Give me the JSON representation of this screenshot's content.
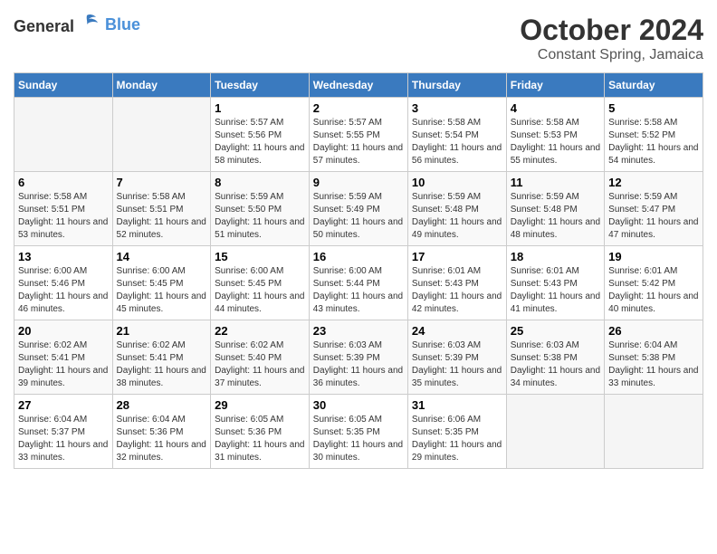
{
  "header": {
    "logo_general": "General",
    "logo_blue": "Blue",
    "month": "October 2024",
    "location": "Constant Spring, Jamaica"
  },
  "days_of_week": [
    "Sunday",
    "Monday",
    "Tuesday",
    "Wednesday",
    "Thursday",
    "Friday",
    "Saturday"
  ],
  "weeks": [
    [
      {
        "day": "",
        "info": ""
      },
      {
        "day": "",
        "info": ""
      },
      {
        "day": "1",
        "info": "Sunrise: 5:57 AM\nSunset: 5:56 PM\nDaylight: 11 hours and 58 minutes."
      },
      {
        "day": "2",
        "info": "Sunrise: 5:57 AM\nSunset: 5:55 PM\nDaylight: 11 hours and 57 minutes."
      },
      {
        "day": "3",
        "info": "Sunrise: 5:58 AM\nSunset: 5:54 PM\nDaylight: 11 hours and 56 minutes."
      },
      {
        "day": "4",
        "info": "Sunrise: 5:58 AM\nSunset: 5:53 PM\nDaylight: 11 hours and 55 minutes."
      },
      {
        "day": "5",
        "info": "Sunrise: 5:58 AM\nSunset: 5:52 PM\nDaylight: 11 hours and 54 minutes."
      }
    ],
    [
      {
        "day": "6",
        "info": "Sunrise: 5:58 AM\nSunset: 5:51 PM\nDaylight: 11 hours and 53 minutes."
      },
      {
        "day": "7",
        "info": "Sunrise: 5:58 AM\nSunset: 5:51 PM\nDaylight: 11 hours and 52 minutes."
      },
      {
        "day": "8",
        "info": "Sunrise: 5:59 AM\nSunset: 5:50 PM\nDaylight: 11 hours and 51 minutes."
      },
      {
        "day": "9",
        "info": "Sunrise: 5:59 AM\nSunset: 5:49 PM\nDaylight: 11 hours and 50 minutes."
      },
      {
        "day": "10",
        "info": "Sunrise: 5:59 AM\nSunset: 5:48 PM\nDaylight: 11 hours and 49 minutes."
      },
      {
        "day": "11",
        "info": "Sunrise: 5:59 AM\nSunset: 5:48 PM\nDaylight: 11 hours and 48 minutes."
      },
      {
        "day": "12",
        "info": "Sunrise: 5:59 AM\nSunset: 5:47 PM\nDaylight: 11 hours and 47 minutes."
      }
    ],
    [
      {
        "day": "13",
        "info": "Sunrise: 6:00 AM\nSunset: 5:46 PM\nDaylight: 11 hours and 46 minutes."
      },
      {
        "day": "14",
        "info": "Sunrise: 6:00 AM\nSunset: 5:45 PM\nDaylight: 11 hours and 45 minutes."
      },
      {
        "day": "15",
        "info": "Sunrise: 6:00 AM\nSunset: 5:45 PM\nDaylight: 11 hours and 44 minutes."
      },
      {
        "day": "16",
        "info": "Sunrise: 6:00 AM\nSunset: 5:44 PM\nDaylight: 11 hours and 43 minutes."
      },
      {
        "day": "17",
        "info": "Sunrise: 6:01 AM\nSunset: 5:43 PM\nDaylight: 11 hours and 42 minutes."
      },
      {
        "day": "18",
        "info": "Sunrise: 6:01 AM\nSunset: 5:43 PM\nDaylight: 11 hours and 41 minutes."
      },
      {
        "day": "19",
        "info": "Sunrise: 6:01 AM\nSunset: 5:42 PM\nDaylight: 11 hours and 40 minutes."
      }
    ],
    [
      {
        "day": "20",
        "info": "Sunrise: 6:02 AM\nSunset: 5:41 PM\nDaylight: 11 hours and 39 minutes."
      },
      {
        "day": "21",
        "info": "Sunrise: 6:02 AM\nSunset: 5:41 PM\nDaylight: 11 hours and 38 minutes."
      },
      {
        "day": "22",
        "info": "Sunrise: 6:02 AM\nSunset: 5:40 PM\nDaylight: 11 hours and 37 minutes."
      },
      {
        "day": "23",
        "info": "Sunrise: 6:03 AM\nSunset: 5:39 PM\nDaylight: 11 hours and 36 minutes."
      },
      {
        "day": "24",
        "info": "Sunrise: 6:03 AM\nSunset: 5:39 PM\nDaylight: 11 hours and 35 minutes."
      },
      {
        "day": "25",
        "info": "Sunrise: 6:03 AM\nSunset: 5:38 PM\nDaylight: 11 hours and 34 minutes."
      },
      {
        "day": "26",
        "info": "Sunrise: 6:04 AM\nSunset: 5:38 PM\nDaylight: 11 hours and 33 minutes."
      }
    ],
    [
      {
        "day": "27",
        "info": "Sunrise: 6:04 AM\nSunset: 5:37 PM\nDaylight: 11 hours and 33 minutes."
      },
      {
        "day": "28",
        "info": "Sunrise: 6:04 AM\nSunset: 5:36 PM\nDaylight: 11 hours and 32 minutes."
      },
      {
        "day": "29",
        "info": "Sunrise: 6:05 AM\nSunset: 5:36 PM\nDaylight: 11 hours and 31 minutes."
      },
      {
        "day": "30",
        "info": "Sunrise: 6:05 AM\nSunset: 5:35 PM\nDaylight: 11 hours and 30 minutes."
      },
      {
        "day": "31",
        "info": "Sunrise: 6:06 AM\nSunset: 5:35 PM\nDaylight: 11 hours and 29 minutes."
      },
      {
        "day": "",
        "info": ""
      },
      {
        "day": "",
        "info": ""
      }
    ]
  ]
}
